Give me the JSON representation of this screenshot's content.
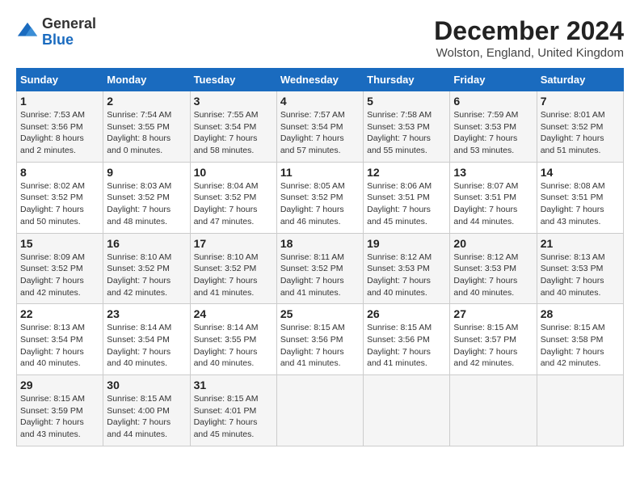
{
  "header": {
    "logo": {
      "general": "General",
      "blue": "Blue"
    },
    "title": "December 2024",
    "location": "Wolston, England, United Kingdom"
  },
  "weekdays": [
    "Sunday",
    "Monday",
    "Tuesday",
    "Wednesday",
    "Thursday",
    "Friday",
    "Saturday"
  ],
  "weeks": [
    [
      {
        "day": "1",
        "sunrise": "Sunrise: 7:53 AM",
        "sunset": "Sunset: 3:56 PM",
        "daylight": "Daylight: 8 hours and 2 minutes."
      },
      {
        "day": "2",
        "sunrise": "Sunrise: 7:54 AM",
        "sunset": "Sunset: 3:55 PM",
        "daylight": "Daylight: 8 hours and 0 minutes."
      },
      {
        "day": "3",
        "sunrise": "Sunrise: 7:55 AM",
        "sunset": "Sunset: 3:54 PM",
        "daylight": "Daylight: 7 hours and 58 minutes."
      },
      {
        "day": "4",
        "sunrise": "Sunrise: 7:57 AM",
        "sunset": "Sunset: 3:54 PM",
        "daylight": "Daylight: 7 hours and 57 minutes."
      },
      {
        "day": "5",
        "sunrise": "Sunrise: 7:58 AM",
        "sunset": "Sunset: 3:53 PM",
        "daylight": "Daylight: 7 hours and 55 minutes."
      },
      {
        "day": "6",
        "sunrise": "Sunrise: 7:59 AM",
        "sunset": "Sunset: 3:53 PM",
        "daylight": "Daylight: 7 hours and 53 minutes."
      },
      {
        "day": "7",
        "sunrise": "Sunrise: 8:01 AM",
        "sunset": "Sunset: 3:52 PM",
        "daylight": "Daylight: 7 hours and 51 minutes."
      }
    ],
    [
      {
        "day": "8",
        "sunrise": "Sunrise: 8:02 AM",
        "sunset": "Sunset: 3:52 PM",
        "daylight": "Daylight: 7 hours and 50 minutes."
      },
      {
        "day": "9",
        "sunrise": "Sunrise: 8:03 AM",
        "sunset": "Sunset: 3:52 PM",
        "daylight": "Daylight: 7 hours and 48 minutes."
      },
      {
        "day": "10",
        "sunrise": "Sunrise: 8:04 AM",
        "sunset": "Sunset: 3:52 PM",
        "daylight": "Daylight: 7 hours and 47 minutes."
      },
      {
        "day": "11",
        "sunrise": "Sunrise: 8:05 AM",
        "sunset": "Sunset: 3:52 PM",
        "daylight": "Daylight: 7 hours and 46 minutes."
      },
      {
        "day": "12",
        "sunrise": "Sunrise: 8:06 AM",
        "sunset": "Sunset: 3:51 PM",
        "daylight": "Daylight: 7 hours and 45 minutes."
      },
      {
        "day": "13",
        "sunrise": "Sunrise: 8:07 AM",
        "sunset": "Sunset: 3:51 PM",
        "daylight": "Daylight: 7 hours and 44 minutes."
      },
      {
        "day": "14",
        "sunrise": "Sunrise: 8:08 AM",
        "sunset": "Sunset: 3:51 PM",
        "daylight": "Daylight: 7 hours and 43 minutes."
      }
    ],
    [
      {
        "day": "15",
        "sunrise": "Sunrise: 8:09 AM",
        "sunset": "Sunset: 3:52 PM",
        "daylight": "Daylight: 7 hours and 42 minutes."
      },
      {
        "day": "16",
        "sunrise": "Sunrise: 8:10 AM",
        "sunset": "Sunset: 3:52 PM",
        "daylight": "Daylight: 7 hours and 42 minutes."
      },
      {
        "day": "17",
        "sunrise": "Sunrise: 8:10 AM",
        "sunset": "Sunset: 3:52 PM",
        "daylight": "Daylight: 7 hours and 41 minutes."
      },
      {
        "day": "18",
        "sunrise": "Sunrise: 8:11 AM",
        "sunset": "Sunset: 3:52 PM",
        "daylight": "Daylight: 7 hours and 41 minutes."
      },
      {
        "day": "19",
        "sunrise": "Sunrise: 8:12 AM",
        "sunset": "Sunset: 3:53 PM",
        "daylight": "Daylight: 7 hours and 40 minutes."
      },
      {
        "day": "20",
        "sunrise": "Sunrise: 8:12 AM",
        "sunset": "Sunset: 3:53 PM",
        "daylight": "Daylight: 7 hours and 40 minutes."
      },
      {
        "day": "21",
        "sunrise": "Sunrise: 8:13 AM",
        "sunset": "Sunset: 3:53 PM",
        "daylight": "Daylight: 7 hours and 40 minutes."
      }
    ],
    [
      {
        "day": "22",
        "sunrise": "Sunrise: 8:13 AM",
        "sunset": "Sunset: 3:54 PM",
        "daylight": "Daylight: 7 hours and 40 minutes."
      },
      {
        "day": "23",
        "sunrise": "Sunrise: 8:14 AM",
        "sunset": "Sunset: 3:54 PM",
        "daylight": "Daylight: 7 hours and 40 minutes."
      },
      {
        "day": "24",
        "sunrise": "Sunrise: 8:14 AM",
        "sunset": "Sunset: 3:55 PM",
        "daylight": "Daylight: 7 hours and 40 minutes."
      },
      {
        "day": "25",
        "sunrise": "Sunrise: 8:15 AM",
        "sunset": "Sunset: 3:56 PM",
        "daylight": "Daylight: 7 hours and 41 minutes."
      },
      {
        "day": "26",
        "sunrise": "Sunrise: 8:15 AM",
        "sunset": "Sunset: 3:56 PM",
        "daylight": "Daylight: 7 hours and 41 minutes."
      },
      {
        "day": "27",
        "sunrise": "Sunrise: 8:15 AM",
        "sunset": "Sunset: 3:57 PM",
        "daylight": "Daylight: 7 hours and 42 minutes."
      },
      {
        "day": "28",
        "sunrise": "Sunrise: 8:15 AM",
        "sunset": "Sunset: 3:58 PM",
        "daylight": "Daylight: 7 hours and 42 minutes."
      }
    ],
    [
      {
        "day": "29",
        "sunrise": "Sunrise: 8:15 AM",
        "sunset": "Sunset: 3:59 PM",
        "daylight": "Daylight: 7 hours and 43 minutes."
      },
      {
        "day": "30",
        "sunrise": "Sunrise: 8:15 AM",
        "sunset": "Sunset: 4:00 PM",
        "daylight": "Daylight: 7 hours and 44 minutes."
      },
      {
        "day": "31",
        "sunrise": "Sunrise: 8:15 AM",
        "sunset": "Sunset: 4:01 PM",
        "daylight": "Daylight: 7 hours and 45 minutes."
      },
      null,
      null,
      null,
      null
    ]
  ]
}
